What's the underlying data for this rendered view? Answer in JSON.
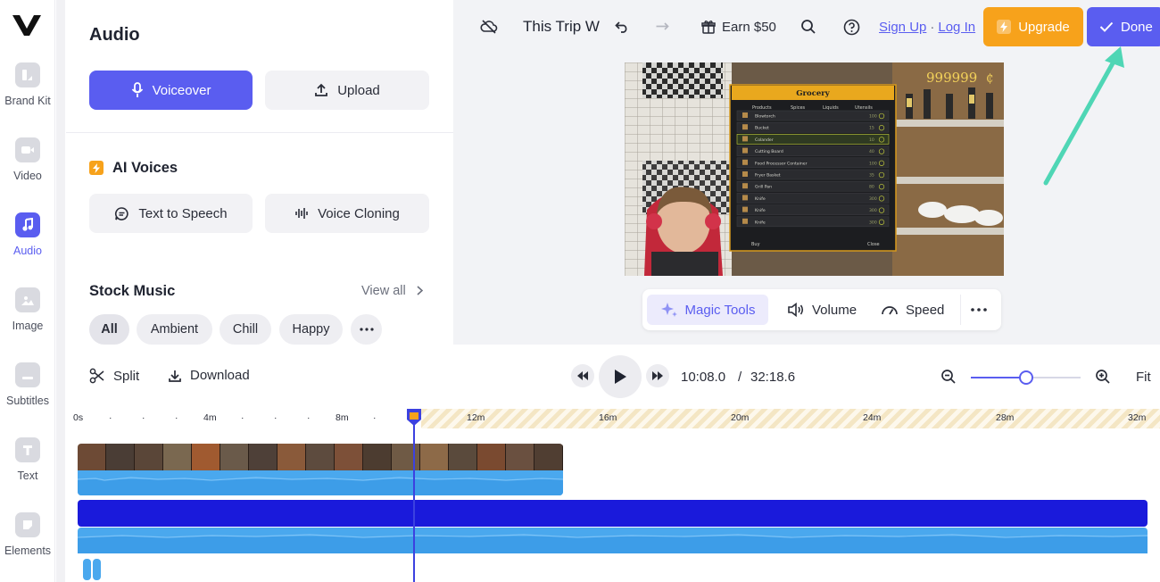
{
  "rail": {
    "items": [
      {
        "label": "Brand Kit",
        "icon": "brand-kit-icon"
      },
      {
        "label": "Video",
        "icon": "video-icon"
      },
      {
        "label": "Audio",
        "icon": "music-note-icon",
        "active": true
      },
      {
        "label": "Image",
        "icon": "image-icon"
      },
      {
        "label": "Subtitles",
        "icon": "subtitles-icon"
      },
      {
        "label": "Text",
        "icon": "text-icon"
      },
      {
        "label": "Elements",
        "icon": "elements-icon"
      }
    ]
  },
  "panel": {
    "title": "Audio",
    "voiceover_label": "Voiceover",
    "upload_label": "Upload",
    "ai_voices_title": "AI Voices",
    "text_to_speech_label": "Text to Speech",
    "voice_cloning_label": "Voice Cloning",
    "stock_music_title": "Stock Music",
    "view_all_label": "View all",
    "chips": [
      "All",
      "Ambient",
      "Chill",
      "Happy"
    ]
  },
  "topbar": {
    "project_title": "This Trip W",
    "earn_label": "Earn $50",
    "sign_up_label": "Sign Up",
    "separator": "·",
    "log_in_label": "Log In",
    "upgrade_label": "Upgrade",
    "done_label": "Done"
  },
  "preview": {
    "money": "999999",
    "currency_sign": "₵",
    "menu_title": "Grocery",
    "tabs": [
      "Products",
      "Spices",
      "Liquids",
      "Utensils"
    ],
    "rows": [
      {
        "name": "Blowtorch",
        "price": "100"
      },
      {
        "name": "Bucket",
        "price": "15"
      },
      {
        "name": "Colander",
        "price": "10"
      },
      {
        "name": "Cutting Board",
        "price": "40"
      },
      {
        "name": "Food Processor Container",
        "price": "100"
      },
      {
        "name": "Fryer Basket",
        "price": "35"
      },
      {
        "name": "Grill Pan",
        "price": "80"
      },
      {
        "name": "Knife",
        "price": "300"
      },
      {
        "name": "Knife",
        "price": "300"
      },
      {
        "name": "Knife",
        "price": "300"
      }
    ],
    "footer_buy": "Buy",
    "footer_close": "Close"
  },
  "preview_toolbar": {
    "magic_tools_label": "Magic Tools",
    "volume_label": "Volume",
    "speed_label": "Speed"
  },
  "timeline": {
    "split_label": "Split",
    "download_label": "Download",
    "current_time": "10:08.0",
    "time_separator": "/",
    "total_time": "32:18.6",
    "fit_label": "Fit",
    "zoom_level": 0.5,
    "ruler_labels": [
      "0s",
      "4m",
      "8m",
      "12m",
      "16m",
      "20m",
      "24m",
      "28m",
      "32m"
    ]
  },
  "colors": {
    "accent": "#5a5df0",
    "upgrade": "#f7a21b",
    "audio_wave": "#4aa8ee",
    "dark_track": "#1a1adb",
    "annotation_arrow": "#4fd6b5"
  }
}
